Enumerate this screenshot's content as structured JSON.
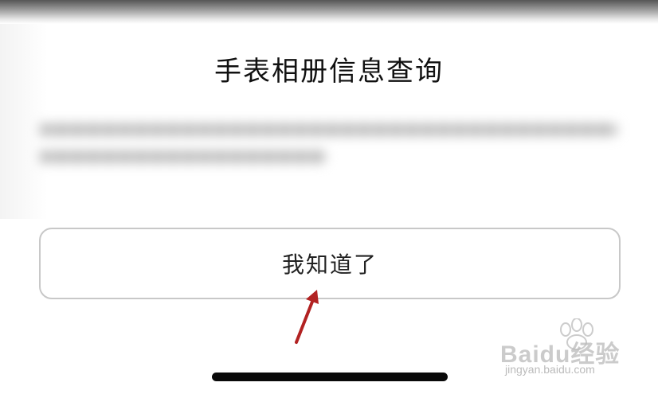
{
  "dialog": {
    "title": "手表相册信息查询",
    "confirm_label": "我知道了"
  },
  "watermark": {
    "brand": "Baidu经验",
    "url": "jingyan.baidu.com"
  },
  "colors": {
    "title_text": "#111111",
    "button_border": "#c8c8c8",
    "arrow": "#b22222",
    "home_indicator": "#0a0a0a"
  },
  "icons": {
    "arrow": "red-arrow-icon",
    "watermark_logo": "baidu-paw-icon"
  }
}
